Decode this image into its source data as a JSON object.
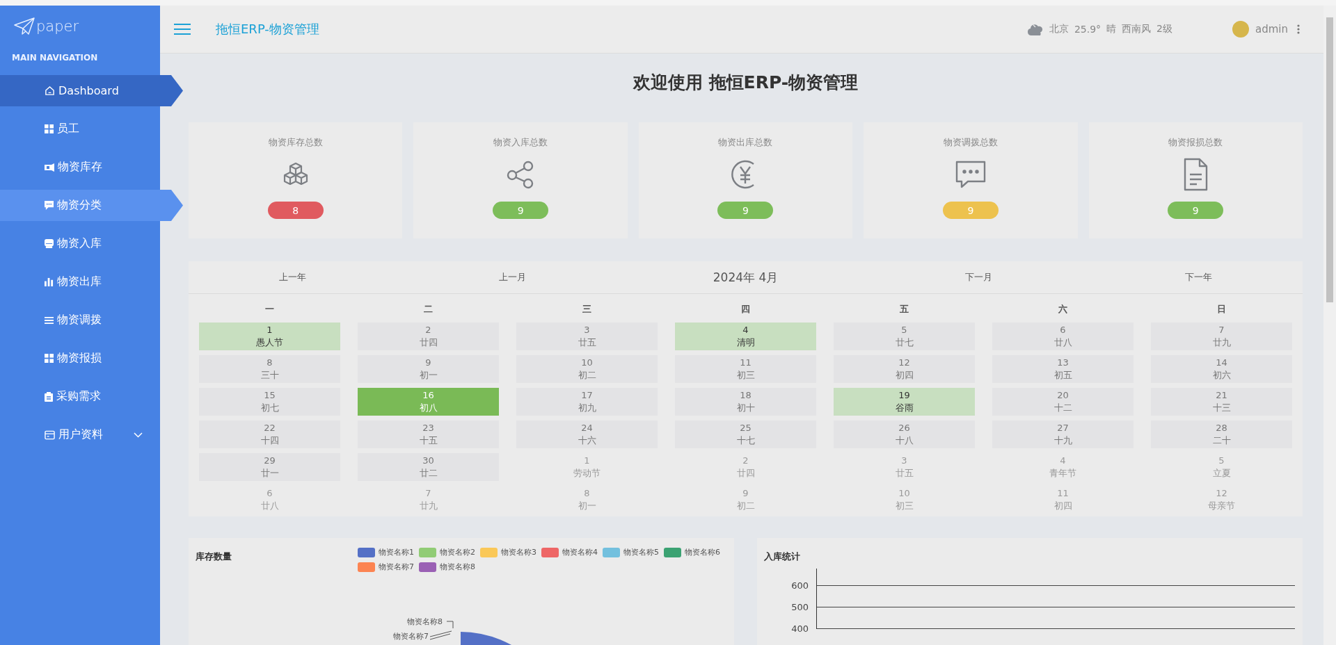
{
  "sidebar": {
    "logo": "paper",
    "section_title": "MAIN NAVIGATION",
    "items": [
      {
        "label": "Dashboard",
        "selected": true,
        "hovered": false,
        "expandable": false
      },
      {
        "label": "员工",
        "selected": false,
        "hovered": false,
        "expandable": false
      },
      {
        "label": "物资库存",
        "selected": false,
        "hovered": false,
        "expandable": false
      },
      {
        "label": "物资分类",
        "selected": false,
        "hovered": true,
        "expandable": false
      },
      {
        "label": "物资入库",
        "selected": false,
        "hovered": false,
        "expandable": false
      },
      {
        "label": "物资出库",
        "selected": false,
        "hovered": false,
        "expandable": false
      },
      {
        "label": "物资调拨",
        "selected": false,
        "hovered": false,
        "expandable": false
      },
      {
        "label": "物资报损",
        "selected": false,
        "hovered": false,
        "expandable": false
      },
      {
        "label": "采购需求",
        "selected": false,
        "hovered": false,
        "expandable": false
      },
      {
        "label": "用户资料",
        "selected": false,
        "hovered": false,
        "expandable": true
      }
    ]
  },
  "header": {
    "title": "拖恒ERP-物资管理",
    "weather": [
      "北京",
      "25.9°",
      "晴",
      "西南风",
      "2级"
    ],
    "user": "admin"
  },
  "page_title": "欢迎使用 拖恒ERP-物资管理",
  "stats": [
    {
      "label": "物资库存总数",
      "count": "8",
      "color": "#e05a5f"
    },
    {
      "label": "物资入库总数",
      "count": "9",
      "color": "#7dbd5a"
    },
    {
      "label": "物资出库总数",
      "count": "9",
      "color": "#7dbd5a"
    },
    {
      "label": "物资调拨总数",
      "count": "9",
      "color": "#edc24e"
    },
    {
      "label": "物资报损总数",
      "count": "9",
      "color": "#7dbd5a"
    }
  ],
  "calendar": {
    "prev_year": "上一年",
    "prev_month": "上一月",
    "month": "2024年 4月",
    "next_month": "下一月",
    "next_year": "下一年",
    "weekdays": [
      "一",
      "二",
      "三",
      "四",
      "五",
      "六",
      "日"
    ],
    "days": [
      {
        "day": "1",
        "lunar": "愚人节",
        "kind": "festival"
      },
      {
        "day": "2",
        "lunar": "廿四",
        "kind": "current"
      },
      {
        "day": "3",
        "lunar": "廿五",
        "kind": "current"
      },
      {
        "day": "4",
        "lunar": "清明",
        "kind": "festival"
      },
      {
        "day": "5",
        "lunar": "廿七",
        "kind": "current"
      },
      {
        "day": "6",
        "lunar": "廿八",
        "kind": "current"
      },
      {
        "day": "7",
        "lunar": "廿九",
        "kind": "current"
      },
      {
        "day": "8",
        "lunar": "三十",
        "kind": "current"
      },
      {
        "day": "9",
        "lunar": "初一",
        "kind": "current"
      },
      {
        "day": "10",
        "lunar": "初二",
        "kind": "current"
      },
      {
        "day": "11",
        "lunar": "初三",
        "kind": "current"
      },
      {
        "day": "12",
        "lunar": "初四",
        "kind": "current"
      },
      {
        "day": "13",
        "lunar": "初五",
        "kind": "current"
      },
      {
        "day": "14",
        "lunar": "初六",
        "kind": "current"
      },
      {
        "day": "15",
        "lunar": "初七",
        "kind": "current"
      },
      {
        "day": "16",
        "lunar": "初八",
        "kind": "today"
      },
      {
        "day": "17",
        "lunar": "初九",
        "kind": "current"
      },
      {
        "day": "18",
        "lunar": "初十",
        "kind": "current"
      },
      {
        "day": "19",
        "lunar": "谷雨",
        "kind": "festival"
      },
      {
        "day": "20",
        "lunar": "十二",
        "kind": "current"
      },
      {
        "day": "21",
        "lunar": "十三",
        "kind": "current"
      },
      {
        "day": "22",
        "lunar": "十四",
        "kind": "current"
      },
      {
        "day": "23",
        "lunar": "十五",
        "kind": "current"
      },
      {
        "day": "24",
        "lunar": "十六",
        "kind": "current"
      },
      {
        "day": "25",
        "lunar": "十七",
        "kind": "current"
      },
      {
        "day": "26",
        "lunar": "十八",
        "kind": "current"
      },
      {
        "day": "27",
        "lunar": "十九",
        "kind": "current"
      },
      {
        "day": "28",
        "lunar": "二十",
        "kind": "current"
      },
      {
        "day": "29",
        "lunar": "廿一",
        "kind": "current"
      },
      {
        "day": "30",
        "lunar": "廿二",
        "kind": "current"
      },
      {
        "day": "1",
        "lunar": "劳动节",
        "kind": "other"
      },
      {
        "day": "2",
        "lunar": "廿四",
        "kind": "other"
      },
      {
        "day": "3",
        "lunar": "廿五",
        "kind": "other"
      },
      {
        "day": "4",
        "lunar": "青年节",
        "kind": "other"
      },
      {
        "day": "5",
        "lunar": "立夏",
        "kind": "other"
      },
      {
        "day": "6",
        "lunar": "廿八",
        "kind": "other"
      },
      {
        "day": "7",
        "lunar": "廿九",
        "kind": "other"
      },
      {
        "day": "8",
        "lunar": "初一",
        "kind": "other"
      },
      {
        "day": "9",
        "lunar": "初二",
        "kind": "other"
      },
      {
        "day": "10",
        "lunar": "初三",
        "kind": "other"
      },
      {
        "day": "11",
        "lunar": "初四",
        "kind": "other"
      },
      {
        "day": "12",
        "lunar": "母亲节",
        "kind": "other"
      }
    ]
  },
  "stock_chart": {
    "title": "库存数量",
    "legend": [
      {
        "label": "物资名称1",
        "color": "#5470c6"
      },
      {
        "label": "物资名称2",
        "color": "#91cc75"
      },
      {
        "label": "物资名称3",
        "color": "#fac858"
      },
      {
        "label": "物资名称4",
        "color": "#ee6666"
      },
      {
        "label": "物资名称5",
        "color": "#73c0de"
      },
      {
        "label": "物资名称6",
        "color": "#3ba272"
      },
      {
        "label": "物资名称7",
        "color": "#fc8452"
      },
      {
        "label": "物资名称8",
        "color": "#9a60b4"
      }
    ],
    "slice_labels": [
      "物资名称8",
      "物资名称7"
    ]
  },
  "stock_in_chart": {
    "title": "入库统计",
    "y_ticks": [
      "600",
      "500",
      "400"
    ]
  }
}
